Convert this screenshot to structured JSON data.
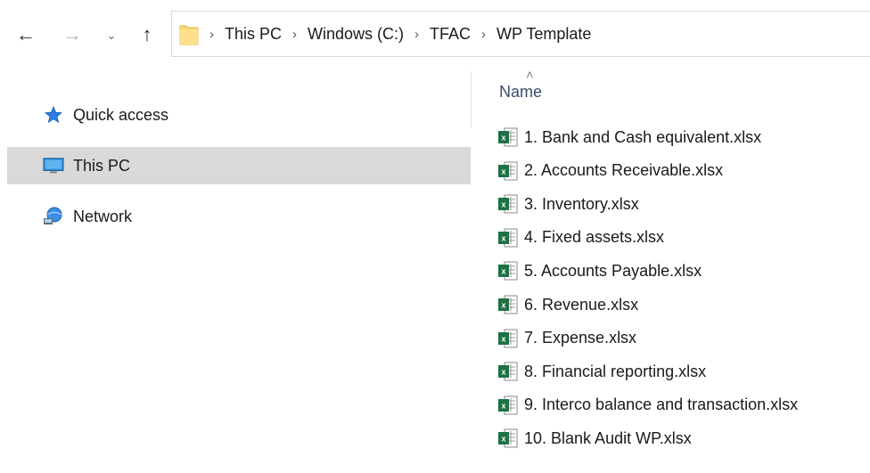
{
  "navigation": {
    "back_icon": "arrow-left-icon",
    "forward_icon": "arrow-right-icon",
    "recent_icon": "chevron-down-icon",
    "up_icon": "arrow-up-icon"
  },
  "address_bar": {
    "icon": "folder-icon",
    "breadcrumbs": [
      "This PC",
      "Windows (C:)",
      "TFAC",
      "WP Template"
    ]
  },
  "sidebar": {
    "items": [
      {
        "label": "Quick access",
        "icon": "star-icon",
        "selected": false
      },
      {
        "label": "This PC",
        "icon": "monitor-icon",
        "selected": true
      },
      {
        "label": "Network",
        "icon": "network-icon",
        "selected": false
      }
    ]
  },
  "file_list": {
    "column_header": "Name",
    "sort_icon": "sort-ascending-icon",
    "files": [
      {
        "name": "1. Bank and Cash equivalent.xlsx",
        "icon": "excel-file-icon"
      },
      {
        "name": "2. Accounts Receivable.xlsx",
        "icon": "excel-file-icon"
      },
      {
        "name": "3. Inventory.xlsx",
        "icon": "excel-file-icon"
      },
      {
        "name": "4. Fixed assets.xlsx",
        "icon": "excel-file-icon"
      },
      {
        "name": "5. Accounts Payable.xlsx",
        "icon": "excel-file-icon"
      },
      {
        "name": "6. Revenue.xlsx",
        "icon": "excel-file-icon"
      },
      {
        "name": "7. Expense.xlsx",
        "icon": "excel-file-icon"
      },
      {
        "name": "8. Financial reporting.xlsx",
        "icon": "excel-file-icon"
      },
      {
        "name": "9. Interco balance and transaction.xlsx",
        "icon": "excel-file-icon"
      },
      {
        "name": "10. Blank Audit WP.xlsx",
        "icon": "excel-file-icon"
      }
    ]
  },
  "colors": {
    "selected_bg": "#d9d9d9",
    "folder_yellow": "#f8d775",
    "excel_green": "#1e7145",
    "header_text": "#3c4e6a"
  }
}
